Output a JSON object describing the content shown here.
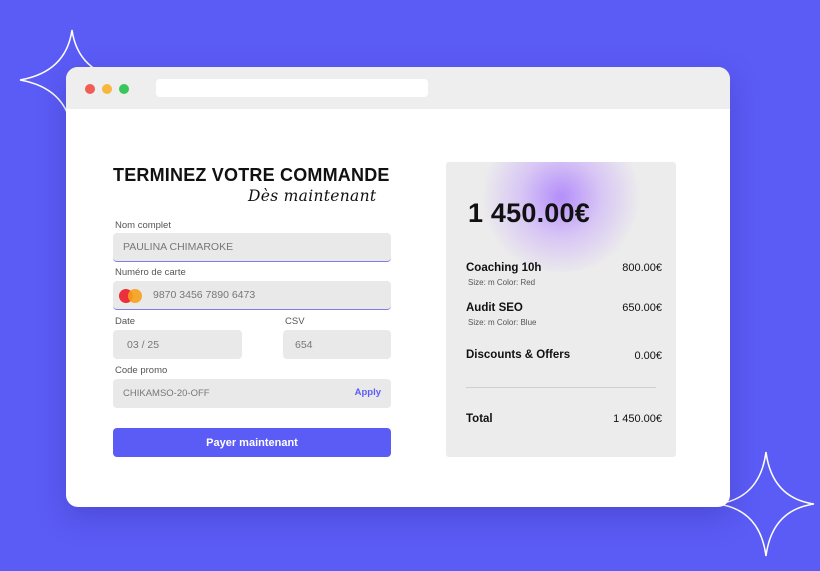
{
  "form": {
    "title": "TERMINEZ VOTRE COMMANDE",
    "subtitle": "Dès maintenant",
    "full_name_label": "Nom complet",
    "full_name_value": "PAULINA CHIMAROKE",
    "card_label": "Numéro de carte",
    "card_value": "9870 3456 7890 6473",
    "date_label": "Date",
    "date_value": "03 / 25",
    "csv_label": "CSV",
    "csv_value": "654",
    "promo_label": "Code promo",
    "promo_value": "CHIKAMSO-20-OFF",
    "apply_label": "Apply",
    "pay_label": "Payer maintenant"
  },
  "summary": {
    "total_big": "1 450.00€",
    "items": [
      {
        "name": "Coaching 10h",
        "meta": "Size: m  Color: Red",
        "price": "800.00€"
      },
      {
        "name": "Audit SEO",
        "meta": "Size: m  Color: Blue",
        "price": "650.00€"
      }
    ],
    "discount_label": "Discounts & Offers",
    "discount_value": "0.00€",
    "total_label": "Total",
    "total_value": "1 450.00€"
  },
  "colors": {
    "background": "#5b5cf6",
    "accent": "#5b5cf6",
    "window": "#ffffff",
    "panel": "#ececec",
    "glow": "#a06eff"
  },
  "icons": [
    "sparkle-icon",
    "mastercard-icon"
  ]
}
